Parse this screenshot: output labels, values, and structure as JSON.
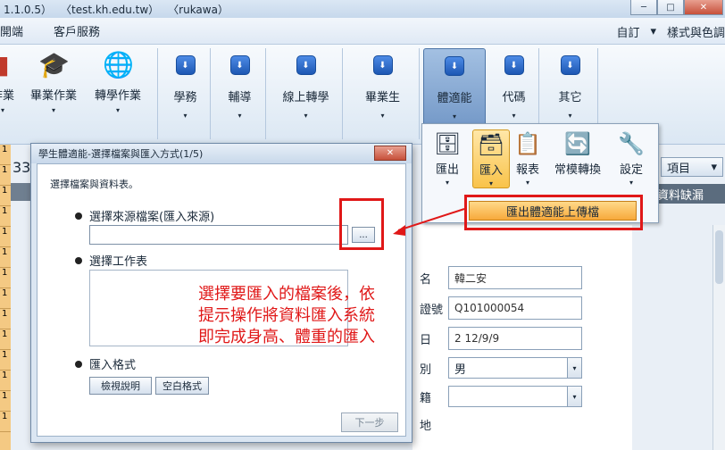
{
  "titlebar": {
    "version": "1.1.0.5）",
    "server": "〈test.kh.edu.tw）",
    "user": "〈rukawa）"
  },
  "window_controls": {
    "minimize": "─",
    "maximize": "□",
    "close": "✕"
  },
  "menubar": {
    "left_item": "開端",
    "customer_service": "客戶服務",
    "custom": "自訂",
    "style_colors": "樣式與色調",
    "caret": "▾"
  },
  "ribbon": {
    "partial_label": "作業",
    "graduation": "畢業作業",
    "transfer": "轉學作業",
    "groups": [
      "學務",
      "輔導",
      "線上轉學",
      "畢業生",
      "體適能",
      "代碼",
      "其它"
    ],
    "caret": "▾",
    "group_icon": "⬇"
  },
  "dropdown": {
    "items": [
      {
        "label": "匯出",
        "icon": "🗄"
      },
      {
        "label": "匯入",
        "icon": "🗃"
      },
      {
        "label": "報表",
        "icon": "📋"
      },
      {
        "label": "常模轉換",
        "icon": "🔄"
      },
      {
        "label": "設定",
        "icon": "🔧"
      }
    ],
    "upload_label": "匯出體適能上傳檔",
    "caret": "▾"
  },
  "dialog": {
    "title": "學生體適能-選擇檔案與匯入方式(1/5)",
    "close": "✕",
    "intro": "選擇檔案與資料表。",
    "source_label": "選擇來源檔案(匯入來源)",
    "browse": "...",
    "sheet_label": "選擇工作表",
    "format_label": "匯入格式",
    "view_spec": "檢視說明",
    "blank_format": "空白格式",
    "next": "下一步"
  },
  "annotation": {
    "line1": "選擇要匯入的檔案後，依",
    "line2": "提示操作將資料匯入系統",
    "line3": "即完成身高、體重的匯入"
  },
  "background": {
    "count": "33",
    "items_button": "項目",
    "items_caret": "▾",
    "missing_data": "資料缺漏",
    "left_rows": [
      "1",
      "1",
      "1",
      "1",
      "1",
      "1",
      "1",
      "1",
      "1",
      "1",
      "1",
      "1",
      "1",
      "1"
    ]
  },
  "form": {
    "name_label": "名",
    "name_value": "韓二安",
    "id_label": "證號",
    "id_value": "Q101000054",
    "date_label": "日",
    "date_value": "2 12/9/9",
    "gender_label": "別",
    "gender_value": "男",
    "origin_label": "籍",
    "origin_value": "",
    "address_label": "地",
    "select_arrow": "▾"
  },
  "colors": {
    "annotation_red": "#e01818",
    "highlight_orange": "#f7a93b",
    "ribbon_blue": "#1d57b3"
  }
}
